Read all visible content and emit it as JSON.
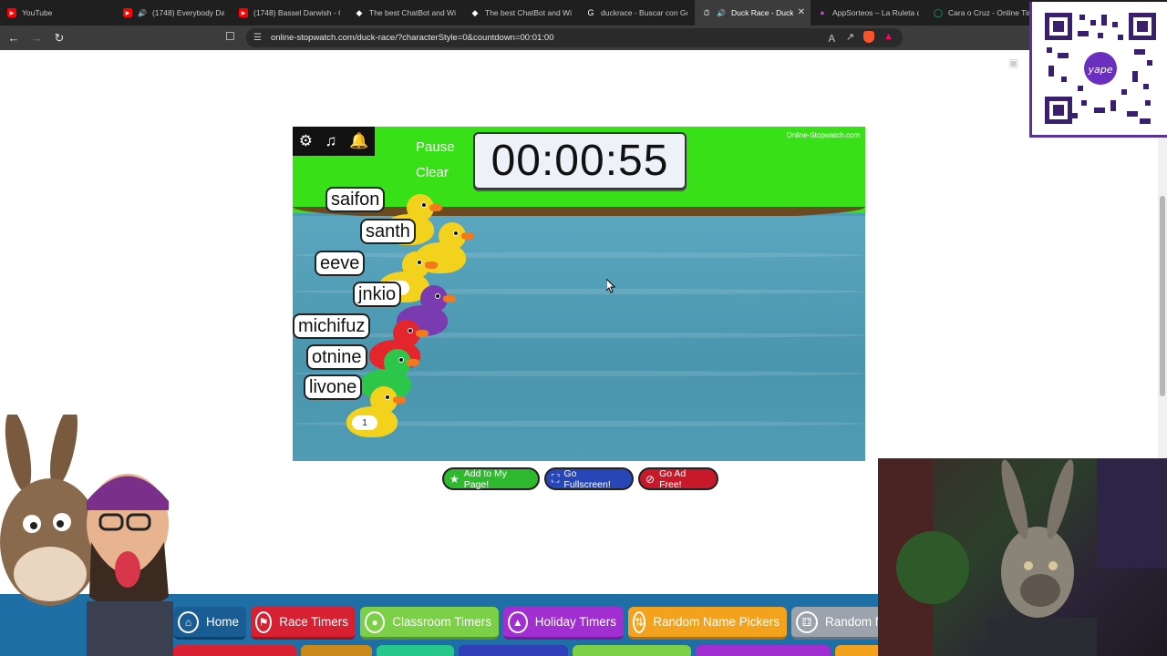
{
  "browser": {
    "tabs": [
      {
        "label": "YouTube",
        "icon": "youtube-icon",
        "active": false
      },
      {
        "label": "(1748) Everybody Dan",
        "icon": "youtube-icon",
        "active": false
      },
      {
        "label": "(1748) Bassel Darwish - Cr",
        "icon": "youtube-icon",
        "active": false
      },
      {
        "label": "The best ChatBot and Wid",
        "icon": "chatbot-icon",
        "active": false
      },
      {
        "label": "The best ChatBot and Wid",
        "icon": "chatbot-icon",
        "active": false
      },
      {
        "label": "duckrace - Buscar con Go",
        "icon": "google-icon",
        "active": false
      },
      {
        "label": "Duck Race - Duck",
        "icon": "stopwatch-icon",
        "active": true
      },
      {
        "label": "AppSorteos – La Ruleta de",
        "icon": "appsorteos-icon",
        "active": false
      },
      {
        "label": "Cara o Cruz - Online Tirar",
        "icon": "coin-icon",
        "active": false
      }
    ],
    "url": "online-stopwatch.com/duck-race/?characterStyle=0&countdown=00:01:00"
  },
  "game": {
    "pause_label": "Pause",
    "clear_label": "Clear",
    "timer": "00:00:55",
    "brand": "Online-Stopwatch.com",
    "ducks": [
      {
        "name": "saifon",
        "color": "#f3d21d"
      },
      {
        "name": "santh",
        "color": "#f3d21d"
      },
      {
        "name": "eeve",
        "color": "#f3d21d",
        "number": "4"
      },
      {
        "name": "jnkio",
        "color": "#7a3bb0"
      },
      {
        "name": "michifuz",
        "color": "#e2262b"
      },
      {
        "name": "otnine",
        "color": "#2bc64a"
      },
      {
        "name": "livone",
        "color": "#f3d21d",
        "number": "1"
      }
    ]
  },
  "actions": {
    "add": "Add to My Page!",
    "fullscreen": "Go Fullscreen!",
    "adfree": "Go Ad Free!"
  },
  "categories": [
    {
      "label": "Home",
      "icon": "home-icon"
    },
    {
      "label": "Race Timers",
      "icon": "runner-icon"
    },
    {
      "label": "Classroom Timers",
      "icon": "apple-icon"
    },
    {
      "label": "Holiday Timers",
      "icon": "tree-icon"
    },
    {
      "label": "Random Name Pickers",
      "icon": "shuffle-icon"
    },
    {
      "label": "Random N",
      "icon": "dice-icon"
    }
  ],
  "overlay": {
    "qr_brand": "yape"
  }
}
